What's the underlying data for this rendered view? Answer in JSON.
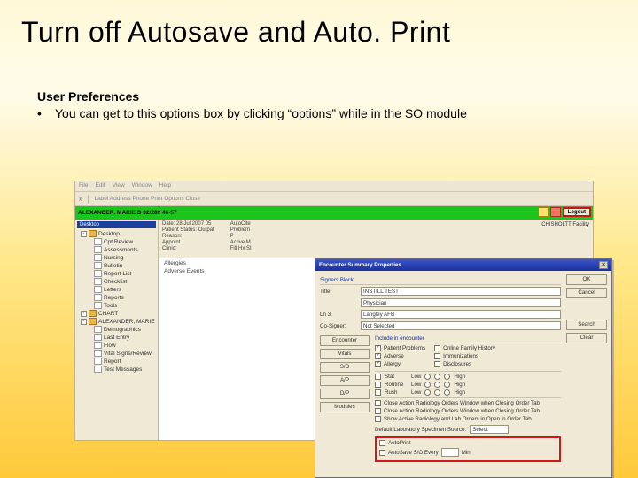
{
  "title": "Turn off Autosave and Auto. Print",
  "subheading": "User Preferences",
  "bullet": "You can get to this options box by clicking “options” while in the SO module",
  "menubar": [
    "File",
    "Edit",
    "View",
    "Window",
    "Help"
  ],
  "toolbar": {
    "chevron": "»",
    "label": "Label  Address  Phone  Print  Options  Close"
  },
  "greenbar": {
    "patient": "ALEXANDER, MARIE D  02/202 46-57",
    "logout": "Logout"
  },
  "facility": "CHISHOLTT Facility",
  "sidebar_header": "Desktop",
  "tree": [
    {
      "exp": "-",
      "type": "fld",
      "label": "Desktop"
    },
    {
      "exp": "",
      "type": "doc",
      "label": "Cpt Review",
      "child": 1
    },
    {
      "exp": "",
      "type": "doc",
      "label": "Assessments",
      "child": 1
    },
    {
      "exp": "",
      "type": "doc",
      "label": "Nursing",
      "child": 1
    },
    {
      "exp": "",
      "type": "doc",
      "label": "Bulletin",
      "child": 1
    },
    {
      "exp": "",
      "type": "doc",
      "label": "Report List",
      "child": 1
    },
    {
      "exp": "",
      "type": "doc",
      "label": "Checklist",
      "child": 1
    },
    {
      "exp": "",
      "type": "doc",
      "label": "Letters",
      "child": 1
    },
    {
      "exp": "",
      "type": "doc",
      "label": "Reports",
      "child": 1
    },
    {
      "exp": "",
      "type": "doc",
      "label": "Tools",
      "child": 1
    },
    {
      "exp": "+",
      "type": "fld",
      "label": "CHART",
      "child": 0
    },
    {
      "exp": "-",
      "type": "fld",
      "label": "ALEXANDER, MARIE D",
      "child": 0
    },
    {
      "exp": "",
      "type": "doc",
      "label": "Demographics",
      "child": 1
    },
    {
      "exp": "",
      "type": "doc",
      "label": "Last Entry",
      "child": 1
    },
    {
      "exp": "",
      "type": "doc",
      "label": "Flow",
      "child": 1
    },
    {
      "exp": "",
      "type": "doc",
      "label": "Vital Signs/Review",
      "child": 1
    },
    {
      "exp": "",
      "type": "doc",
      "label": "Report",
      "child": 1
    },
    {
      "exp": "",
      "type": "doc",
      "label": "Test Messages",
      "child": 1
    }
  ],
  "info": {
    "col1": [
      "Date: 28 Jul 2007 05",
      "Patient Status: Outpat",
      "Reason:",
      "Appoint",
      "Clinic:"
    ],
    "col2_labels": [
      "AutoCite",
      "Problem",
      "P",
      "Active M",
      "Fill Hx SI"
    ]
  },
  "checklist": [
    "Allergies",
    "Adverse Events"
  ],
  "dialog": {
    "title": "Encounter Summary Properties",
    "buttons": {
      "ok": "OK",
      "cancel": "Cancel",
      "search": "Search",
      "clear": "Clear"
    },
    "signer_section": "Signers Block",
    "fields": {
      "f1_label": "Title:",
      "f1_value": "INSTILL TEST",
      "f2_label": "",
      "f2_value": "Physician",
      "f3_label": "Ln 3:",
      "f3_value": "Langley AFB",
      "cosign_label": "Co-Signer:",
      "cosign_value": "Not Selected"
    },
    "side_buttons": [
      "Encounter",
      "Vitals",
      "S/O",
      "A/P",
      "D/P",
      "Modules"
    ],
    "checks_section": "Include in encounter",
    "include_checks": [
      {
        "checked": true,
        "label": "Patient Problems"
      },
      {
        "checked": true,
        "label": "Adverse"
      },
      {
        "checked": true,
        "label": "Allergy"
      },
      {
        "checked": false,
        "label": "Online Family History"
      },
      {
        "checked": false,
        "label": "Immunizations"
      },
      {
        "checked": false,
        "label": "Disclosures"
      }
    ],
    "priority_header": "",
    "priorities": [
      {
        "name": "Stat",
        "low": "Low",
        "high": "High"
      },
      {
        "name": "Routine",
        "low": "Low",
        "high": "High"
      },
      {
        "name": "Rush",
        "low": "Low",
        "high": "High"
      }
    ],
    "action_checks": [
      "Close Action Radiology Orders Window when Closing Order Tab",
      "Close Action Radiology Orders Window when Closing Order Tab",
      "Show Active Radiology and Lab Orders in Open in Order Tab"
    ],
    "default_label": "Default Laboratory Specimen Source:",
    "default_value": "Select",
    "red_checks": [
      {
        "label": "AutoPrint"
      },
      {
        "label": "AutoSave S/O Every",
        "extra": "Min"
      }
    ]
  }
}
